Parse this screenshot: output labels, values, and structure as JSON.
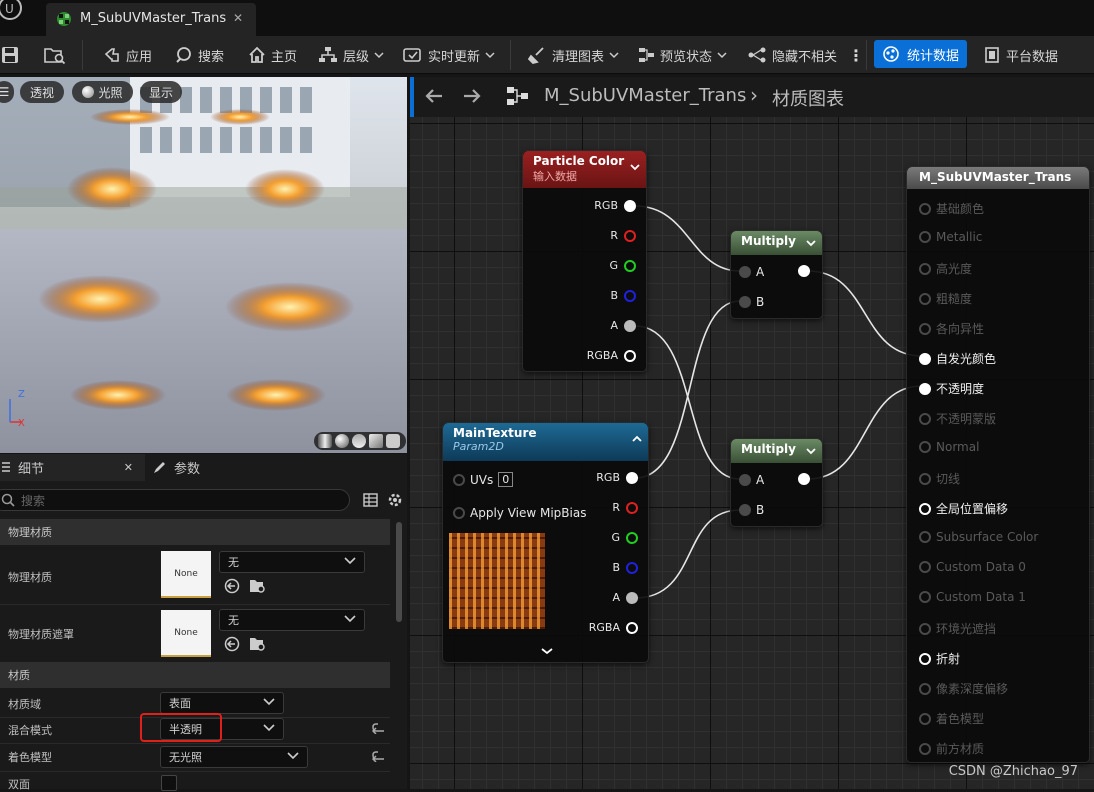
{
  "tab": {
    "title": "M_SubUVMaster_Trans",
    "close": "✕"
  },
  "toolbar": {
    "apply": "应用",
    "search": "搜索",
    "home": "主页",
    "hierarchy": "层级",
    "live_update": "实时更新",
    "clean_graph": "清理图表",
    "preview_state": "预览状态",
    "hide_unrelated": "隐藏不相关",
    "stats": "统计数据",
    "platform_stats": "平台数据"
  },
  "viewport": {
    "perspective": "透视",
    "lit": "光照",
    "show": "显示",
    "axis_z": "Z",
    "axis_x": "X"
  },
  "details": {
    "tab_details": "细节",
    "tab_params": "参数",
    "tab_close": "✕",
    "search_placeholder": "搜索",
    "cat_physical": "物理材质",
    "phys_mat_label": "物理材质",
    "phys_mat_value": "无",
    "phys_mat_thumb": "None",
    "phys_mask_label": "物理材质遮罩",
    "phys_mask_value": "无",
    "phys_mask_thumb": "None",
    "cat_material": "材质",
    "domain_label": "材质域",
    "domain_value": "表面",
    "blend_label": "混合模式",
    "blend_value": "半透明",
    "shading_label": "着色模型",
    "shading_value": "无光照",
    "twosided_label": "双面"
  },
  "graph": {
    "breadcrumb_asset": "M_SubUVMaster_Trans",
    "breadcrumb_sep": "›",
    "breadcrumb_graph": "材质图表",
    "particle": {
      "title": "Particle Color",
      "subtitle": "输入数据",
      "outputs": [
        "RGB",
        "R",
        "G",
        "B",
        "A",
        "RGBA"
      ]
    },
    "mult1": {
      "title": "Multiply",
      "in_a": "A",
      "in_b": "B"
    },
    "mult2": {
      "title": "Multiply",
      "in_a": "A",
      "in_b": "B"
    },
    "tex": {
      "title": "MainTexture",
      "subtitle": "Param2D",
      "uvs": "UVs",
      "uvs_value": "0",
      "mipbias": "Apply View MipBias",
      "outputs": [
        "RGB",
        "R",
        "G",
        "B",
        "A",
        "RGBA"
      ]
    },
    "result": {
      "title": "M_SubUVMaster_Trans",
      "inputs": [
        "基础颜色",
        "Metallic",
        "高光度",
        "粗糙度",
        "各向异性",
        "自发光颜色",
        "不透明度",
        "不透明蒙版",
        "Normal",
        "切线",
        "全局位置偏移",
        "Subsurface Color",
        "Custom Data 0",
        "Custom Data 1",
        "环境光遮挡",
        "折射",
        "像素深度偏移",
        "着色模型",
        "前方材质"
      ],
      "active": [
        false,
        false,
        false,
        false,
        false,
        true,
        true,
        false,
        false,
        false,
        true,
        false,
        false,
        false,
        false,
        true,
        false,
        false,
        false
      ]
    }
  },
  "watermark": "CSDN @Zhichao_97",
  "colors": {
    "accent": "#1a6fd8",
    "highlight": "#e0201a",
    "particle_head": "#8a1a1a",
    "texture_head": "#1a5a80",
    "multiply_head": "#5a7a56"
  }
}
